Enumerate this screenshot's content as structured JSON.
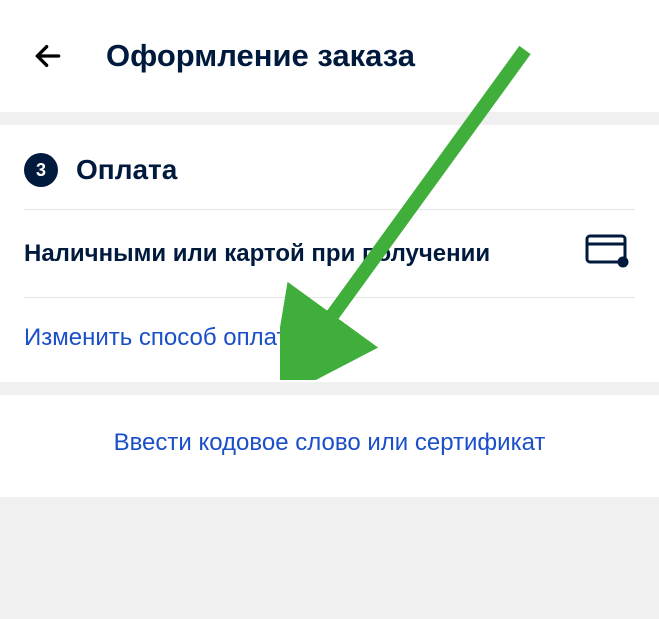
{
  "header": {
    "title": "Оформление заказа"
  },
  "payment_section": {
    "step_number": "3",
    "title": "Оплата",
    "method_line": "Наличными или картой при получении",
    "change_link": "Изменить способ оплаты"
  },
  "certificate": {
    "link": "Ввести кодовое слово или сертификат"
  },
  "colors": {
    "text_dark": "#001a3d",
    "link_blue": "#1a4fc7",
    "arrow_green": "#3fae3a"
  }
}
